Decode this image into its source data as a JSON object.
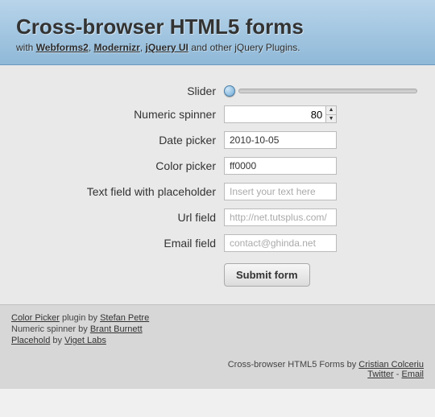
{
  "header": {
    "title": "Cross-browser HTML5 forms",
    "sub_prefix": "with ",
    "link1": "Webforms2",
    "sep1": ", ",
    "link2": "Modernizr",
    "sep2": ", ",
    "link3": "jQuery UI",
    "sub_suffix": " and other jQuery Plugins."
  },
  "form": {
    "slider_label": "Slider",
    "spinner_label": "Numeric spinner",
    "spinner_value": "80",
    "date_label": "Date picker",
    "date_value": "2010-10-05",
    "color_label": "Color picker",
    "color_value": "ff0000",
    "text_label": "Text field with placeholder",
    "text_placeholder": "Insert your text here",
    "url_label": "Url field",
    "url_placeholder": "http://net.tutsplus.com/",
    "email_label": "Email field",
    "email_placeholder": "contact@ghinda.net",
    "submit_label": "Submit form"
  },
  "footer": {
    "l1_link": "Color Picker",
    "l1_mid": " plugin by ",
    "l1_author": "Stefan Petre",
    "l2_prefix": "Numeric spinner by ",
    "l2_author": "Brant Burnett",
    "l3_link": "Placehold",
    "l3_mid": " by ",
    "l3_author": "Viget Labs",
    "b_prefix": "Cross-browser HTML5 Forms by ",
    "b_author": "Cristian Colceriu",
    "b_twitter": "Twitter",
    "b_sep": " - ",
    "b_email": "Email"
  }
}
